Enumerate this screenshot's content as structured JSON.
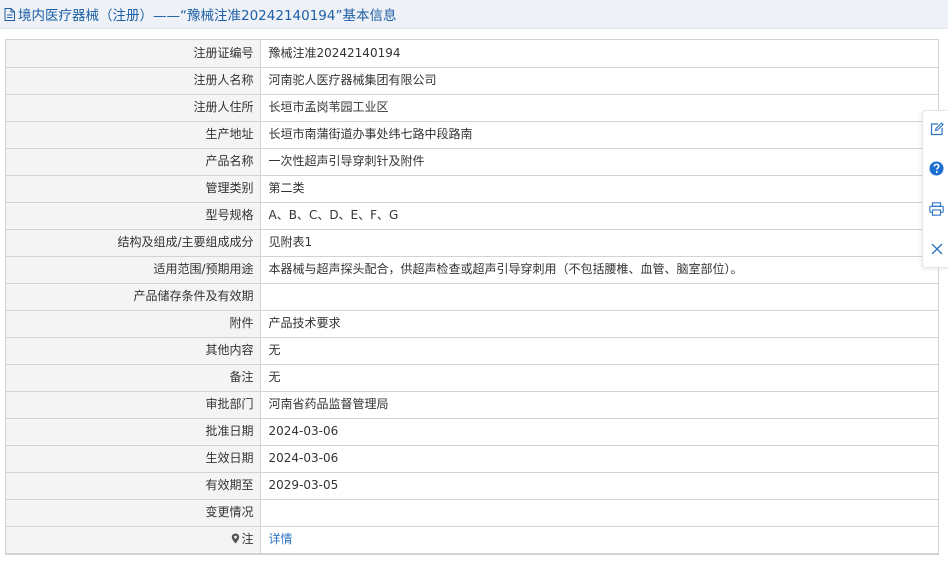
{
  "page": {
    "title": "境内医疗器械（注册）——“豫械注准20242140194”基本信息"
  },
  "rows": [
    {
      "label": "注册证编号",
      "value": "豫械注准20242140194"
    },
    {
      "label": "注册人名称",
      "value": "河南驼人医疗器械集团有限公司"
    },
    {
      "label": "注册人住所",
      "value": "长垣市孟岗苇园工业区"
    },
    {
      "label": "生产地址",
      "value": "长垣市南蒲街道办事处纬七路中段路南"
    },
    {
      "label": "产品名称",
      "value": "一次性超声引导穿刺针及附件"
    },
    {
      "label": "管理类别",
      "value": "第二类"
    },
    {
      "label": "型号规格",
      "value": "A、B、C、D、E、F、G"
    },
    {
      "label": "结构及组成/主要组成成分",
      "value": "见附表1"
    },
    {
      "label": "适用范围/预期用途",
      "value": "本器械与超声探头配合，供超声检查或超声引导穿刺用（不包括腰椎、血管、脑室部位）。"
    },
    {
      "label": "产品储存条件及有效期",
      "value": ""
    },
    {
      "label": "附件",
      "value": "产品技术要求"
    },
    {
      "label": "其他内容",
      "value": "无"
    },
    {
      "label": "备注",
      "value": "无"
    },
    {
      "label": "审批部门",
      "value": "河南省药品监督管理局"
    },
    {
      "label": "批准日期",
      "value": "2024-03-06"
    },
    {
      "label": "生效日期",
      "value": "2024-03-06"
    },
    {
      "label": "有效期至",
      "value": "2029-03-05"
    },
    {
      "label": "变更情况",
      "value": ""
    }
  ],
  "note_row": {
    "label": "注",
    "link_text": "详情"
  },
  "icons": {
    "title": "document-icon",
    "note": "pin-icon",
    "side": [
      "edit-icon",
      "help-icon",
      "print-icon",
      "close-icon"
    ]
  },
  "colors": {
    "accent": "#1d5fa8",
    "link": "#2f75c6",
    "help_icon": "#1c6fd1",
    "label_bg": "#f4f4f4",
    "header_bg": "#eef1f5",
    "border": "#d0d4d9"
  }
}
